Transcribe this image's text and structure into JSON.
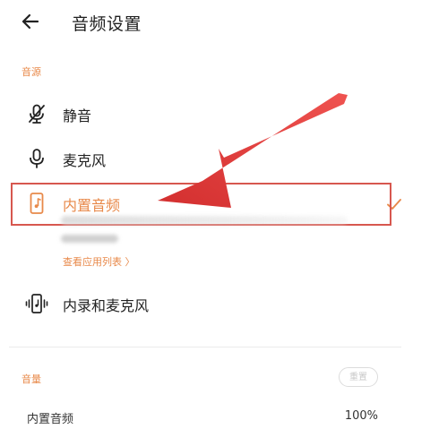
{
  "header": {
    "back_icon": "arrow-left-icon",
    "title": "音频设置"
  },
  "audio_source": {
    "section_label": "音源",
    "options": [
      {
        "label": "静音",
        "icon": "mic-off-icon"
      },
      {
        "label": "麦克风",
        "icon": "microphone-icon"
      },
      {
        "label": "内置音频",
        "icon": "phone-music-icon",
        "selected": true
      },
      {
        "label": "内录和麦克风",
        "icon": "phone-vibrate-icon"
      }
    ],
    "app_list_link": "查看应用列表 〉"
  },
  "volume": {
    "section_label": "音量",
    "reset_label": "重置",
    "items": [
      {
        "label": "内置音频",
        "value": "100%"
      }
    ]
  },
  "colors": {
    "accent": "#e8894a",
    "highlight_border": "#d7574f",
    "annotation_arrow": "#e53935"
  }
}
